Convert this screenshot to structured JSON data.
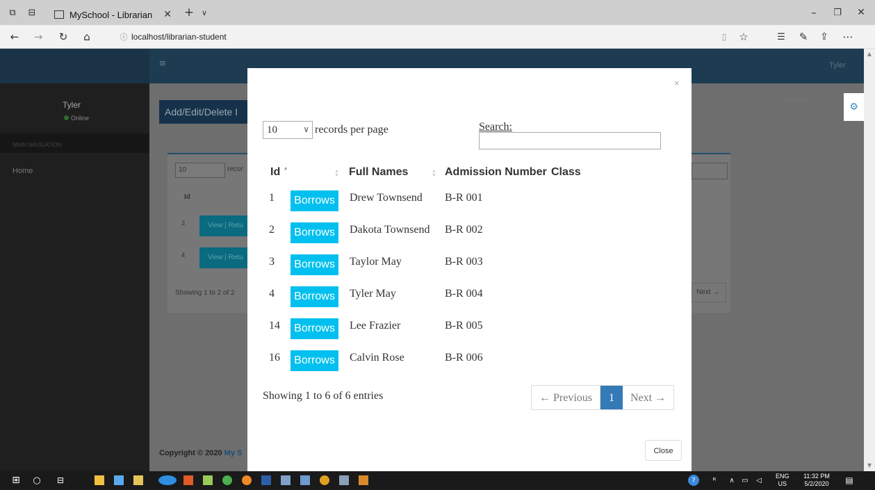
{
  "browser": {
    "tab_title": "MySchool - Librarian",
    "url": "localhost/librarian-student"
  },
  "sidebar": {
    "user_name": "Tyler",
    "status": "Online",
    "nav_header": "MAIN NAVIGATION",
    "nav_home": "Home"
  },
  "header": {
    "user": "Tyler",
    "page_title": "Add/Edit/Delete I",
    "breadcrumb": "Home > Li"
  },
  "background_table": {
    "length_value": "10",
    "length_label": "recor",
    "id_header": "Id",
    "rows": [
      {
        "id": "3",
        "action": "View | Retu"
      },
      {
        "id": "4",
        "action": "View | Retu"
      }
    ],
    "info": "Showing 1 to 2 of 2",
    "next": "Next →",
    "footer": "Copyright © 2020 ",
    "footer_link": "My S"
  },
  "modal": {
    "close_x": "×",
    "length_value": "10",
    "records_per_page": "records per page",
    "search_label": "Search:",
    "search_value": "",
    "columns": [
      "Id",
      "Full Names",
      "Admission Number",
      "Class"
    ],
    "borrow_label": "Borrows",
    "rows": [
      {
        "id": "1",
        "name": "Drew Townsend",
        "admission": "B-R 001",
        "class": ""
      },
      {
        "id": "2",
        "name": "Dakota Townsend",
        "admission": "B-R 002",
        "class": ""
      },
      {
        "id": "3",
        "name": "Taylor May",
        "admission": "B-R 003",
        "class": ""
      },
      {
        "id": "4",
        "name": "Tyler May",
        "admission": "B-R 004",
        "class": ""
      },
      {
        "id": "14",
        "name": "Lee Frazier",
        "admission": "B-R 005",
        "class": ""
      },
      {
        "id": "16",
        "name": "Calvin Rose",
        "admission": "B-R 006",
        "class": ""
      }
    ],
    "info": "Showing 1 to 6 of 6 entries",
    "pagination": {
      "previous": "← Previous",
      "current": "1",
      "next": "Next →"
    },
    "close_button": "Close"
  },
  "taskbar": {
    "lang": "ENG",
    "region": "US",
    "time": "11:32 PM",
    "date": "5/2/2020"
  }
}
